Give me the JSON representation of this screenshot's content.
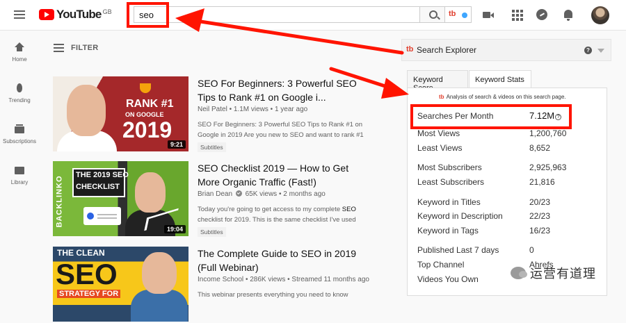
{
  "header": {
    "logo_text": "YouTube",
    "region": "GB",
    "search_value": "seo",
    "extension_label": "tb"
  },
  "sidebar": {
    "items": [
      {
        "label": "Home",
        "icon": "home-icon"
      },
      {
        "label": "Trending",
        "icon": "trending-icon"
      },
      {
        "label": "Subscriptions",
        "icon": "subscriptions-icon"
      },
      {
        "label": "Library",
        "icon": "library-icon"
      }
    ]
  },
  "filter": {
    "label": "FILTER"
  },
  "videos": [
    {
      "title": "SEO For Beginners: 3 Powerful SEO Tips to Rank #1 on Google i...",
      "channel": "Neil Patel",
      "meta": "• 1.1M views • 1 year ago",
      "description": "SEO For Beginners: 3 Powerful SEO Tips to Rank #1 on Google in 2019 Are you new to SEO and want to rank #1",
      "badge": "Subtitles",
      "duration": "9:21",
      "thumb_lines": [
        "RANK #1",
        "ON GOOGLE",
        "2019"
      ]
    },
    {
      "title": "SEO Checklist 2019 — How to Get More Organic Traffic (Fast!)",
      "channel": "Brian Dean",
      "meta": "65K views • 2 months ago",
      "desc_pre": "Today you're going to get access to my complete ",
      "desc_bold": "SEO",
      "desc_post": " checklist for 2019. This is the same checklist I've used",
      "badge": "Subtitles",
      "duration": "19:04",
      "thumb_lines": [
        "THE 2019 SEO",
        "CHECKLIST",
        "BACKLINKO"
      ]
    },
    {
      "title": "The Complete Guide to SEO in 2019 (Full Webinar)",
      "channel": "Income School",
      "meta": "• 286K views • Streamed 11 months ago",
      "description": "This webinar presents everything you need to know",
      "thumb_lines": [
        "THE CLEAN",
        "SEO",
        "STRATEGY FOR"
      ]
    }
  ],
  "panel": {
    "logo": "tb",
    "title": "Search Explorer",
    "help": "?",
    "tabs": [
      "Keyword Score",
      "Keyword Stats"
    ],
    "analysis": "Analysis of search & videos on this search page.",
    "stats": [
      {
        "label": "Searches Per Month",
        "value": "7.12M"
      },
      {
        "label": "Most Views",
        "value": "1,200,760"
      },
      {
        "label": "Least Views",
        "value": "8,652"
      },
      {
        "label": "Most Subscribers",
        "value": "2,925,963"
      },
      {
        "label": "Least Subscribers",
        "value": "21,816"
      },
      {
        "label": "Keyword in Titles",
        "value": "20/23"
      },
      {
        "label": "Keyword in Description",
        "value": "22/23"
      },
      {
        "label": "Keyword in Tags",
        "value": "16/23"
      },
      {
        "label": "Published Last 7 days",
        "value": "0"
      },
      {
        "label": "Top Channel",
        "value": "Ahrefs"
      },
      {
        "label": "Videos You Own",
        "value": ""
      }
    ]
  },
  "watermark": {
    "text": "运营有道理"
  },
  "colors": {
    "annotation": "#ff1400",
    "youtube_red": "#ff0000",
    "tubebuddy": "#e03e2d"
  }
}
